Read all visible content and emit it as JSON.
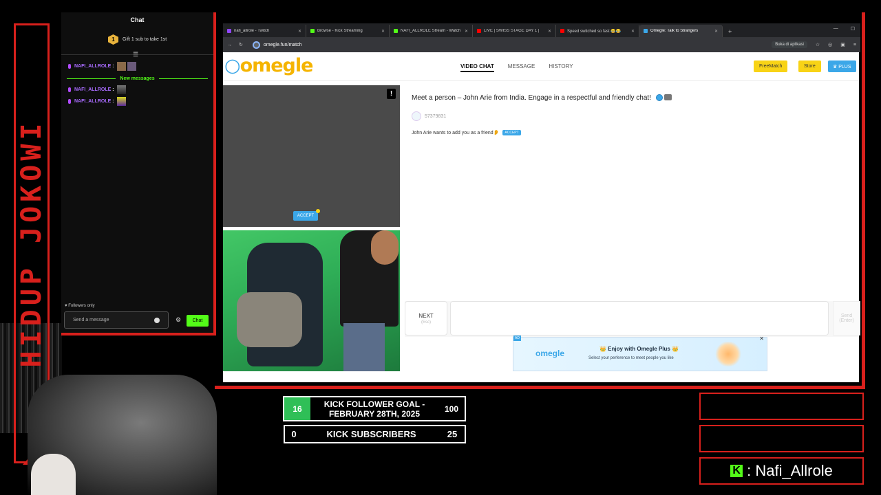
{
  "side_banner": {
    "text": "HIDUP JOKOWI"
  },
  "chat": {
    "title": "Chat",
    "gift": {
      "badge": "1",
      "text": "Gift 1 sub to take 1st"
    },
    "messages": [
      {
        "user": "NAFI_ALLROLE"
      },
      {
        "user": "NAFI_ALLROLE"
      },
      {
        "user": "NAFI_ALLROLE"
      }
    ],
    "new_messages_label": "New messages",
    "followers_only": "♥ Followers only",
    "input_placeholder": "Send a message",
    "send_label": "Chat",
    "accent": "#53fc18",
    "username_color": "#a96cff"
  },
  "browser": {
    "tabs": [
      {
        "title": "nafi_allrole - Twitch",
        "color": "#9146ff"
      },
      {
        "title": "Browse - Kick Streaming",
        "color": "#53fc18"
      },
      {
        "title": "NAFI_ALLROLE Stream - Watch",
        "color": "#53fc18"
      },
      {
        "title": "LIVE | SWISS STAGE DAY 1 |",
        "color": "#ff0000"
      },
      {
        "title": "Speed switched so fast 😂😂",
        "color": "#ff0000"
      },
      {
        "title": "Omegle: Talk to Strangers",
        "color": "#3ba7e8"
      }
    ],
    "url": "omegle.fun/match",
    "open_app_label": "Buka di aplikasi"
  },
  "omegle": {
    "logo": "omegle",
    "nav": {
      "video_chat": "VIDEO CHAT",
      "message": "MESSAGE",
      "history": "HISTORY"
    },
    "free_match": "FreeMatch",
    "store": "Store",
    "plus": "♛ PLUS",
    "report": "!",
    "accept": "ACCEPT",
    "intro": "Meet a person – John Arie from India. Engage in a respectful and friendly chat!",
    "stranger_id": "57379831",
    "friend_request": "John Arie wants to add you as a friend👂",
    "mini_accept": "ACCEPT",
    "next_label": "NEXT",
    "next_hint": "(Esc)",
    "send_label": "Send",
    "send_hint": "(Enter)",
    "ad": {
      "tag": "AD",
      "close": "✕",
      "logo": "omegle",
      "title": "👑 Enjoy with Omegle Plus 👑",
      "subtitle": "Select your perference to meet people you like"
    },
    "colors": {
      "brand_yellow": "#f5b400",
      "brand_blue": "#3ba7e8"
    }
  },
  "goals": {
    "follower": {
      "current": "16",
      "label": "KICK FOLLOWER GOAL - FEBRUARY 28TH, 2025",
      "target": "100"
    },
    "subscriber": {
      "current": "0",
      "label": "KICK SUBSCRIBERS",
      "target": "25"
    }
  },
  "social": {
    "icon": "K",
    "handle": ": Nafi_Allrole"
  },
  "frame_color": "#d8201c"
}
